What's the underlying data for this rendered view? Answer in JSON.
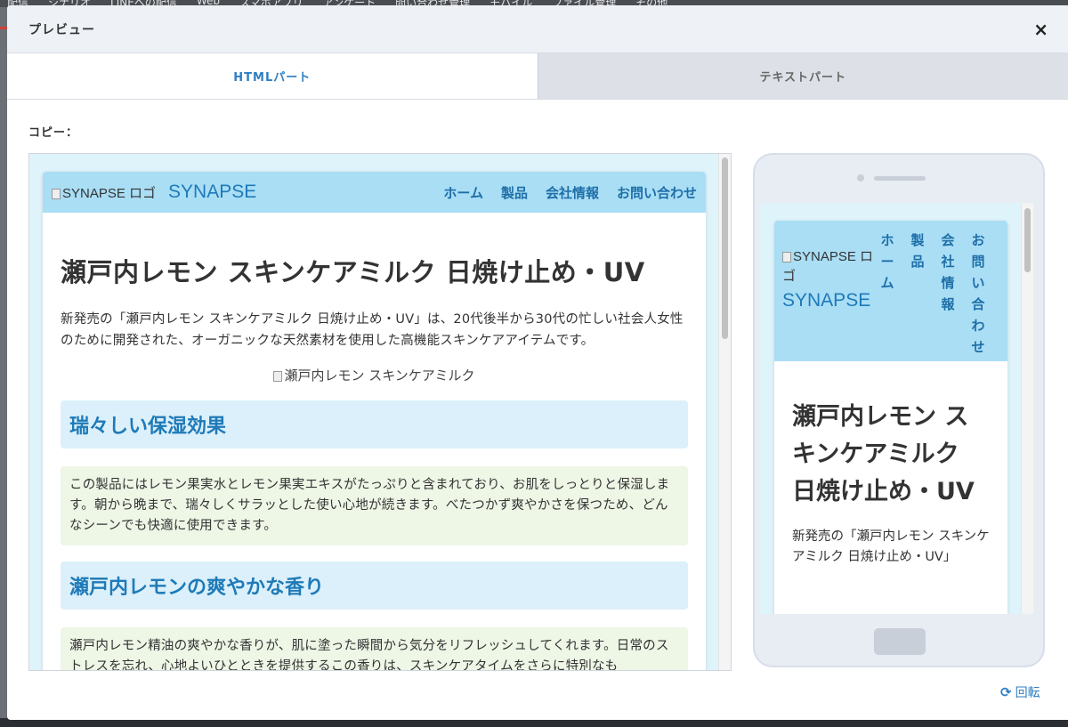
{
  "background": {
    "menu": [
      "配信",
      "シナリオ",
      "LINEへの配信",
      "Web",
      "スマホアプリ",
      "アンケート",
      "問い合わせ管理",
      "モバイル",
      "ファイル管理",
      "その他"
    ]
  },
  "modal": {
    "title": "プレビュー",
    "close_label": "×",
    "tabs": [
      {
        "label": "HTMLパート",
        "active": true
      },
      {
        "label": "テキストパート",
        "active": false
      }
    ],
    "copy_label": "コピー：",
    "rotate_label": "回転"
  },
  "preview": {
    "logo_alt": "SYNAPSE ロゴ",
    "brand": "SYNAPSE",
    "nav": [
      "ホーム",
      "製品",
      "会社情報",
      "お問い合わせ"
    ],
    "title": "瀬戸内レモン スキンケアミルク 日焼け止め・UV",
    "intro": "新発売の「瀬戸内レモン スキンケアミルク 日焼け止め・UV」は、20代後半から30代の忙しい社会人女性のために開発された、オーガニックな天然素材を使用した高機能スキンケアアイテムです。",
    "hero_alt": "瀬戸内レモン スキンケアミルク",
    "sections": [
      {
        "heading": "瑞々しい保湿効果",
        "text": "この製品にはレモン果実水とレモン果実エキスがたっぷりと含まれており、お肌をしっとりと保湿します。朝から晩まで、瑞々しくサラッとした使い心地が続きます。べたつかず爽やかさを保つため、どんなシーンでも快適に使用できます。"
      },
      {
        "heading": "瀬戸内レモンの爽やかな香り",
        "text": "瀬戸内レモン精油の爽やかな香りが、肌に塗った瞬間から気分をリフレッシュしてくれます。日常のストレスを忘れ、心地よいひとときを提供するこの香りは、スキンケアタイムをさらに特別なも"
      }
    ],
    "mobile_intro": "新発売の「瀬戸内レモン スキンケアミルク 日焼け止め・UV」"
  },
  "colors": {
    "accent": "#2f7ec2",
    "nav_bg": "#a9def5",
    "section_heading_bg": "#dbf0fa",
    "section_text_bg": "#eef6e6"
  }
}
